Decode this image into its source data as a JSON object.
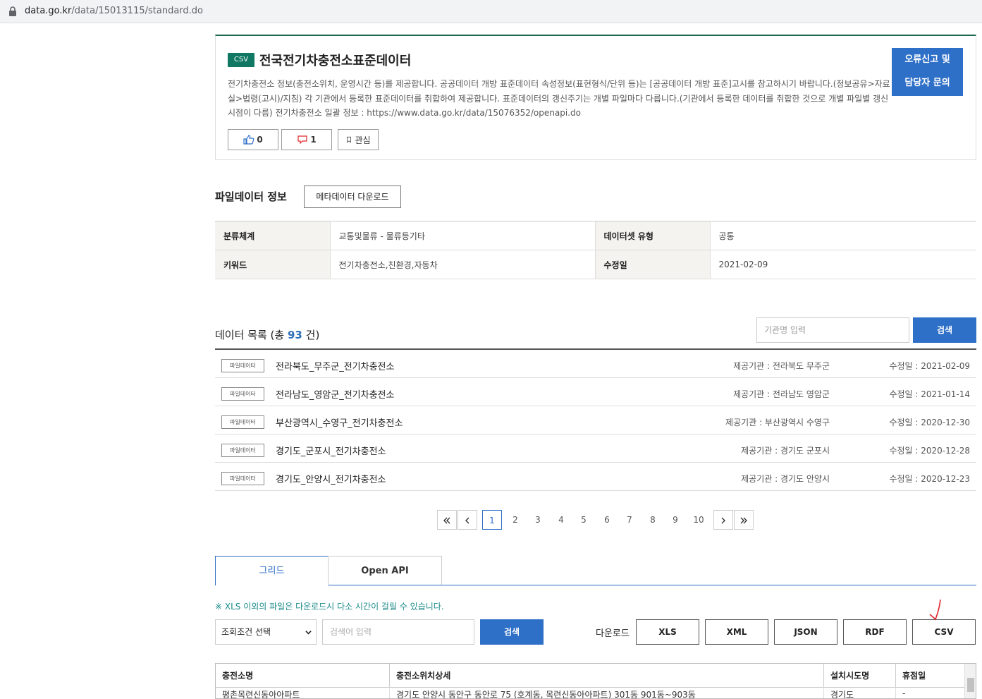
{
  "browser": {
    "url_host": "data.go.kr",
    "url_path": "/data/15013115/standard.do"
  },
  "header": {
    "badge": "CSV",
    "title": "전국전기차충전소표준데이터",
    "description": "전기차충전소 정보(충전소위치, 운영시간 등)를 제공합니다. 공공데이터 개방 표준데이터 속성정보(표현형식/단위 등)는 [공공데이터 개방 표준]고시를 참고하시기 바랍니다.(정보공유>자료실>법령(고시)/지침) 각 기관에서 등록한 표준데이터를 취합하여 제공합니다. 표준데이터의 갱신주기는 개별 파일마다 다릅니다.(기관에서 등록한 데이터를 취합한 것으로 개별 파일별 갱신시점이 다름) 전기차충전소 일괄 정보 : https://www.data.go.kr/data/15076352/openapi.do",
    "report_line1": "오류신고 및",
    "report_line2": "담당자 문의",
    "like_count": "0",
    "dislike_count": "1",
    "bookmark_label": "관심"
  },
  "file_info": {
    "title": "파일데이터 정보",
    "meta_download": "메타데이터 다운로드",
    "rows": [
      {
        "k1": "분류체계",
        "v1": "교통및물류 - 물류등기타",
        "k2": "데이터셋 유형",
        "v2": "공통"
      },
      {
        "k1": "키워드",
        "v1": "전기차충전소,친환경,자동차",
        "k2": "수정일",
        "v2": "2021-02-09"
      }
    ]
  },
  "data_list": {
    "title_prefix": "데이터 목록 (총",
    "count": "93",
    "title_suffix": "건)",
    "search_placeholder": "기관명 입력",
    "search_button": "검색",
    "tag_label": "파일데이터",
    "items": [
      {
        "title": "전라북도_무주군_전기차충전소",
        "org": "제공기관 : 전라북도 무주군",
        "date": "수정일 : 2021-02-09"
      },
      {
        "title": "전라남도_영암군_전기차충전소",
        "org": "제공기관 : 전라남도 영암군",
        "date": "수정일 : 2021-01-14"
      },
      {
        "title": "부산광역시_수영구_전기차충전소",
        "org": "제공기관 : 부산광역시 수영구",
        "date": "수정일 : 2020-12-30"
      },
      {
        "title": "경기도_군포시_전기차충전소",
        "org": "제공기관 : 경기도 군포시",
        "date": "수정일 : 2020-12-28"
      },
      {
        "title": "경기도_안양시_전기차충전소",
        "org": "제공기관 : 경기도 안양시",
        "date": "수정일 : 2020-12-23"
      }
    ]
  },
  "pagination": {
    "pages": [
      "1",
      "2",
      "3",
      "4",
      "5",
      "6",
      "7",
      "8",
      "9",
      "10"
    ],
    "current": "1"
  },
  "tabs": {
    "grid": "그리드",
    "openapi": "Open API"
  },
  "grid_panel": {
    "notice": "※ XLS 이외의 파일은 다운로드시 다소 시간이 걸릴 수 있습니다.",
    "select_value": "조회조건 선택",
    "keyword_placeholder": "검색어 입력",
    "search_button": "검색",
    "download_label": "다운로드",
    "formats": [
      "XLS",
      "XML",
      "JSON",
      "RDF",
      "CSV"
    ],
    "columns": [
      "충전소명",
      "충전소위치상세",
      "설치시도명",
      "휴점일"
    ],
    "first_row": [
      "평촌목련신동아아파트",
      "경기도 안양시 동안구 동안로 75 (호계동, 목련신동아아파트) 301동 901동~903동",
      "경기도",
      "-"
    ]
  },
  "colors": {
    "accent": "#2e6fc7",
    "badge": "#117864",
    "header_border": "#1b6b52",
    "annotation": "#e0262b"
  }
}
